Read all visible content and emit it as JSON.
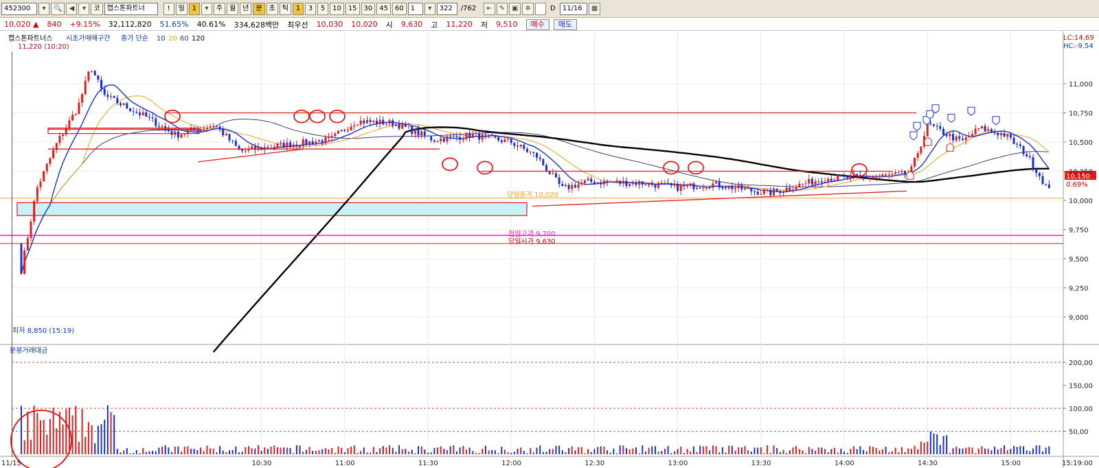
{
  "toolbar": {
    "code": "452300",
    "market": "코",
    "name": "캡스톤파트너",
    "bang": "!",
    "period_day": "일",
    "period_num": "1",
    "periods": [
      "주",
      "월",
      "년",
      "분",
      "초",
      "틱"
    ],
    "minutes": [
      "3",
      "5",
      "10",
      "15",
      "30",
      "45",
      "60"
    ],
    "count": "1",
    "range": "322",
    "range_total": "/762",
    "date": "11/16",
    "checkbox_label": "D"
  },
  "quote": {
    "price": "10,020",
    "change": "840",
    "change_pct": "+9.15%",
    "volume": "32,112,820",
    "pct1": "51.65%",
    "pct2": "40.61%",
    "amount": "334,628백만",
    "best_ask_label": "최우선",
    "best_ask": "10,030",
    "best_bid": "10,020",
    "open_label": "시",
    "open": "9,630",
    "high_label": "고",
    "high": "11,220",
    "low_label": "저",
    "low": "9,510",
    "buy_label": "매수",
    "sell_label": "매도"
  },
  "panel": {
    "name": "캡스톤파트너스",
    "indicator_label": "시초가매매구간",
    "ma_label": "종가 단순",
    "ma_periods": [
      "10",
      "20",
      "60",
      "120"
    ],
    "lc": "LC:14.69",
    "hc": "HC:-9.54",
    "high_note": "11,220 (10:20)",
    "low_note": "최저 8,850 (15:19)",
    "prev_high_label": "전일고가 9,700",
    "open_label": "당일시가 9,630",
    "open_price_label": "당일종가 10,020",
    "current_price": "10,150",
    "current_pct": "0.69%",
    "volume_title": "분봉거래대금"
  },
  "colors": {
    "ma10": "#1230d8",
    "ma20": "#f0a020",
    "ma60": "#3a3a7a",
    "ma120": "#000000",
    "up": "#e41b1b",
    "down": "#1b2fd6",
    "magenta": "#ff10d0",
    "resistance": "#e41b1b",
    "zone": "#c8f2f8"
  },
  "chart_data": {
    "type": "candlestick",
    "y_ticks": [
      "11,000",
      "10,750",
      "10,500",
      "10,250",
      "10,000",
      "9,750",
      "9,500",
      "9,250",
      "9,000"
    ],
    "y_range": [
      8800,
      11400
    ],
    "time_labels": [
      "11/15",
      "10:30",
      "11:00",
      "11:30",
      "12:00",
      "12:30",
      "13:00",
      "13:30",
      "14:00",
      "14:30",
      "15:00",
      "15:19:00"
    ],
    "time_range": [
      "09:00",
      "15:19"
    ],
    "reference_lines": [
      {
        "name": "prev-high",
        "value": 9700
      },
      {
        "name": "open",
        "value": 9630
      },
      {
        "name": "last-close",
        "value": 10020
      }
    ],
    "resistance_levels": [
      10750,
      10610,
      10440,
      10250
    ],
    "volume_ticks": [
      "200,00",
      "150,00",
      "100,00",
      "50,00"
    ],
    "volume_range": [
      0,
      230
    ],
    "volume_gridlines": [
      200,
      100,
      50
    ]
  }
}
